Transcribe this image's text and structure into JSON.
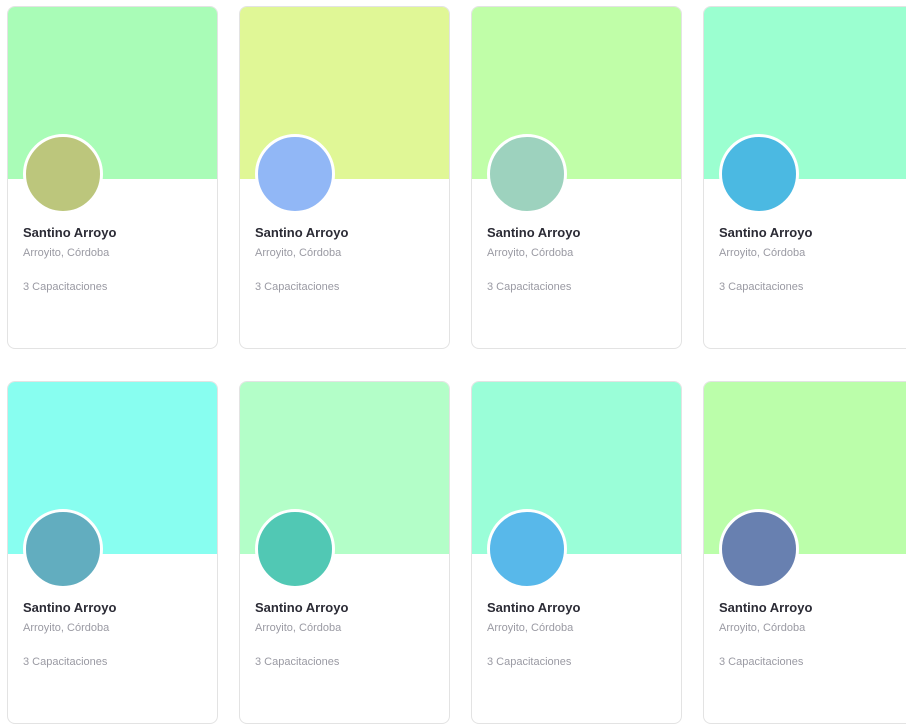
{
  "cards": [
    {
      "name": "Santino Arroyo",
      "location": "Arroyito, Córdoba",
      "trainings": "3 Capacitaciones",
      "cover_color": "#a9fcb7",
      "avatar_color": "#bcc67c"
    },
    {
      "name": "Santino Arroyo",
      "location": "Arroyito, Córdoba",
      "trainings": "3 Capacitaciones",
      "cover_color": "#e0f796",
      "avatar_color": "#91b7f6"
    },
    {
      "name": "Santino Arroyo",
      "location": "Arroyito, Córdoba",
      "trainings": "3 Capacitaciones",
      "cover_color": "#c0fea8",
      "avatar_color": "#9dd2be"
    },
    {
      "name": "Santino Arroyo",
      "location": "Arroyito, Córdoba",
      "trainings": "3 Capacitaciones",
      "cover_color": "#9bffd0",
      "avatar_color": "#4bb9e2"
    },
    {
      "name": "Santino Arroyo",
      "location": "Arroyito, Córdoba",
      "trainings": "3 Capacitaciones",
      "cover_color": "#88fef0",
      "avatar_color": "#62adbf"
    },
    {
      "name": "Santino Arroyo",
      "location": "Arroyito, Córdoba",
      "trainings": "3 Capacitaciones",
      "cover_color": "#b3fec8",
      "avatar_color": "#51c8b4"
    },
    {
      "name": "Santino Arroyo",
      "location": "Arroyito, Córdoba",
      "trainings": "3 Capacitaciones",
      "cover_color": "#9afed8",
      "avatar_color": "#58b8ea"
    },
    {
      "name": "Santino Arroyo",
      "location": "Arroyito, Córdoba",
      "trainings": "3 Capacitaciones",
      "cover_color": "#bbfeaa",
      "avatar_color": "#6880b0"
    }
  ]
}
